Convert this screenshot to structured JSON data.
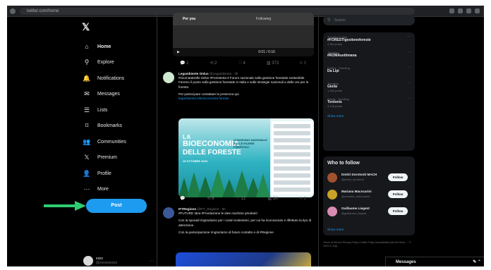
{
  "browser": {
    "url": "twitter.com/home"
  },
  "nav": {
    "logo": "𝕏",
    "items": [
      {
        "label": "Home",
        "icon": "⌂"
      },
      {
        "label": "Explore",
        "icon": "⚲"
      },
      {
        "label": "Notifications",
        "icon": "🔔"
      },
      {
        "label": "Messages",
        "icon": "✉"
      },
      {
        "label": "Lists",
        "icon": "☰"
      },
      {
        "label": "Bookmarks",
        "icon": "⌑"
      },
      {
        "label": "Communities",
        "icon": "👥"
      },
      {
        "label": "Premium",
        "icon": "𝕏"
      },
      {
        "label": "Profile",
        "icon": "👤"
      },
      {
        "label": "More",
        "icon": "⋯"
      }
    ],
    "post_label": "Post",
    "user": {
      "name": "xxxx",
      "handle": "@xxxxxxxxxx",
      "more": "···"
    }
  },
  "feed": {
    "video": {
      "tab1": "Per you",
      "tab2": "Following",
      "time": "0:01 / 0:16"
    },
    "actions1": [
      "💬 1",
      "⟲ 2",
      "♡ 4",
      "▥ 373",
      "⌑ ⇪"
    ],
    "tweet1": {
      "name": "Legambiente Onlus",
      "handle": "@Legambiente · 3h",
      "text": "#GiornataDelle Selve #ForesteIta Il Forum nazionale sulla gestione forestale sostenibile. Faremo il punto sulla gestione forestale in Italia e sulle strategie nazionali a delle ore per le foreste.",
      "text2": "Per partecipare contattare la presenza qui",
      "link": "legambiente.it/bioeconomia-foreste"
    },
    "poster": {
      "title1": "LA",
      "title2": "BIOECONOMIA",
      "title3": "DELLE FORESTE",
      "subtitle": "CONVEGNO NAZIONALE SULLE FILIERE FORESTALI",
      "dates": "19 OTTOBRE 2023"
    },
    "actions2": [
      "💬",
      "⟲ 8",
      "♡ 12",
      "▥ 1K",
      "⌑ ⇪"
    ],
    "tweet2": {
      "name": "IFTRegione",
      "handle": "@IFT_Regione · 5h",
      "text": "#FUTURE Idea #Fondazione le idee machine prioritari!",
      "text2": "Con la sporadi ringraziamo per i nostri sostenitori, per cui ha riconosciuto e riflettuto la tipo di attenzione.",
      "text3": "Con la partecipazione ringraziamo di futuro contatto e di #Regione"
    }
  },
  "right": {
    "search_placeholder": "Search",
    "trends": [
      {
        "meta": "Trending in Italy",
        "title": "#FORESTIgestioneforeste",
        "sub": "2,354 posts"
      },
      {
        "meta": "Trending",
        "title": "#ROMAsettimana",
        "sub": ""
      },
      {
        "meta": "Politics · Trending",
        "title": "Da Lipi",
        "sub": ""
      },
      {
        "meta": "Trending",
        "title": "Giulia",
        "sub": "1,160 posts"
      },
      {
        "meta": "Sports · Trending",
        "title": "Tontonis",
        "sub": "3,125 posts"
      }
    ],
    "trends_more": "Show more",
    "wtf": {
      "title": "Who to follow",
      "people": [
        {
          "name": "Dmitri Dorotonti MACH",
          "handle": "@dmitri_dorotonti"
        },
        {
          "name": "Mariana Macocarini",
          "handle": "@mariana_macocarini"
        },
        {
          "name": "Guillaume Liegent",
          "handle": "@guillaume_liegent"
        }
      ],
      "follow_label": "Follow",
      "more": "Show more"
    },
    "footer": "Terms of Service  Privacy Policy  Cookie Policy  Accessibility  Ads info  More ···  © 2023 X Corp."
  },
  "messages": {
    "label": "Messages",
    "icons": "✎ ⌃"
  },
  "colors": {
    "accent": "#1d9bf0",
    "arrow": "#2ecc71",
    "bg": "#000000"
  }
}
